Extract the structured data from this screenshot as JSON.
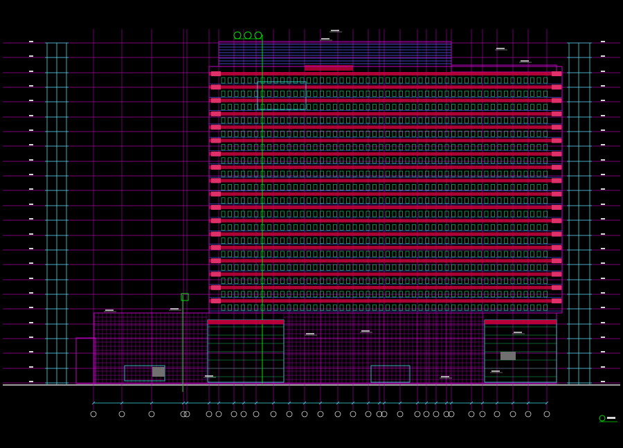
{
  "drawing": {
    "colors": {
      "background": "#000000",
      "gridMagenta": "#c000c0",
      "gridBlue": "#5a5aff",
      "structureRed": "#c8003c",
      "windowGreen": "#20c060",
      "dimCyan": "#40e0e0",
      "annotWhite": "#d8d8d8",
      "axisGreen": "#00e000"
    },
    "levels": 24,
    "grid_axes": 29,
    "axis_bubbles_top": [
      "",
      "",
      ""
    ],
    "title_mark": ""
  }
}
